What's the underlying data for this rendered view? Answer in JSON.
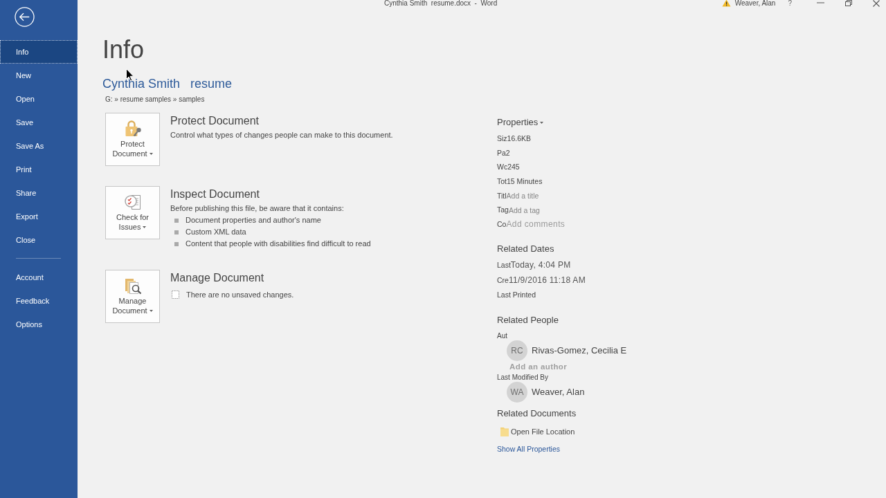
{
  "title_bar": {
    "title": "Cynthia Smith  resume.docx  -  Word",
    "user": "Weaver, Alan",
    "help": "?"
  },
  "sidebar": {
    "items": [
      {
        "label": "Info",
        "selected": true
      },
      {
        "label": "New",
        "selected": false
      },
      {
        "label": "Open",
        "selected": false
      },
      {
        "label": "Save",
        "selected": false
      },
      {
        "label": "Save As",
        "selected": false
      },
      {
        "label": "Print",
        "selected": false
      },
      {
        "label": "Share",
        "selected": false
      },
      {
        "label": "Export",
        "selected": false
      },
      {
        "label": "Close",
        "selected": false
      }
    ],
    "footer_items": [
      {
        "label": "Account",
        "selected": false
      },
      {
        "label": "Feedback",
        "selected": false
      },
      {
        "label": "Options",
        "selected": false
      }
    ]
  },
  "page": {
    "heading": "Info",
    "doc_title": "Cynthia Smith   resume",
    "path": "G: » resume samples » samples"
  },
  "sections": [
    {
      "kind": "protect",
      "button_lines": [
        "Protect",
        "Document"
      ],
      "heading": "Protect Document",
      "description": "Control what types of changes people can make to this document."
    },
    {
      "kind": "inspect",
      "button_lines": [
        "Check for",
        "Issues"
      ],
      "heading": "Inspect Document",
      "description": "Before publishing this file, be aware that it contains:",
      "bullets": [
        "Document properties and author's name",
        "Custom XML data",
        "Content that people with disabilities find difficult to read"
      ]
    },
    {
      "kind": "manage",
      "button_lines": [
        "Manage",
        "Document"
      ],
      "heading": "Manage Document",
      "note": "There are no unsaved changes."
    }
  ],
  "properties": {
    "heading": "Properties",
    "rows": [
      {
        "kind": "value",
        "label": "Siz",
        "value": "16.6KB"
      },
      {
        "kind": "value",
        "label": "Pa",
        "value": "2"
      },
      {
        "kind": "value",
        "label": "Wc",
        "value": "245"
      },
      {
        "kind": "value",
        "label": "Tot",
        "value": "15 Minutes"
      },
      {
        "kind": "field",
        "label": "Titl",
        "placeholder": "Add a title"
      },
      {
        "kind": "field",
        "label": "Tag",
        "placeholder": "Add a tag"
      },
      {
        "kind": "comments",
        "label": "Co",
        "placeholder": "Add comments"
      }
    ]
  },
  "related_dates": {
    "heading": "Related Dates",
    "rows": [
      {
        "label": "Last",
        "value": "Today, 4:04 PM"
      },
      {
        "label": "Cre",
        "value": "11/9/2016 11:18 AM"
      },
      {
        "label": "Last Printed"
      }
    ]
  },
  "related_people": {
    "heading": "Related People",
    "people": [
      {
        "kind": "person",
        "label": "Aut",
        "initials": "RC",
        "name": "Rivas-Gomez, Cecilia E"
      },
      {
        "kind": "add",
        "label": "Add an author"
      },
      {
        "kind": "person",
        "label": "Last Modified By",
        "initials": "WA",
        "name": "Weaver, Alan"
      }
    ]
  },
  "related_documents": {
    "heading": "Related Documents",
    "items": [
      {
        "label": "Open File Location"
      }
    ],
    "link": "Show All Properties"
  }
}
